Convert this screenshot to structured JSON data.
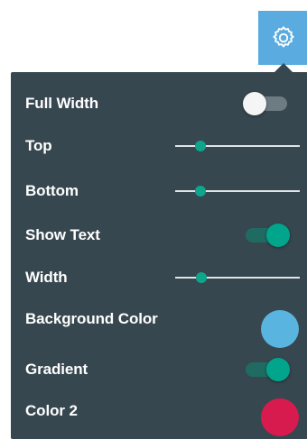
{
  "settings_button": {
    "icon": "gear-icon"
  },
  "panel": {
    "rows": [
      {
        "label": "Full Width",
        "control": "toggle",
        "on": false
      },
      {
        "label": "Top",
        "control": "slider",
        "value_fraction": 0.2
      },
      {
        "label": "Bottom",
        "control": "slider",
        "value_fraction": 0.2
      },
      {
        "label": "Show Text",
        "control": "toggle",
        "on": true
      },
      {
        "label": "Width",
        "control": "slider",
        "value_fraction": 0.21
      },
      {
        "label": "Background Color",
        "control": "color",
        "color": "#5ab4e0"
      },
      {
        "label": "Gradient",
        "control": "toggle",
        "on": true
      },
      {
        "label": "Color 2",
        "control": "color",
        "color": "#d81b4f"
      }
    ]
  },
  "colors": {
    "accent": "#5aace0",
    "panel_bg": "#37474f",
    "teal": "#00a58c"
  }
}
